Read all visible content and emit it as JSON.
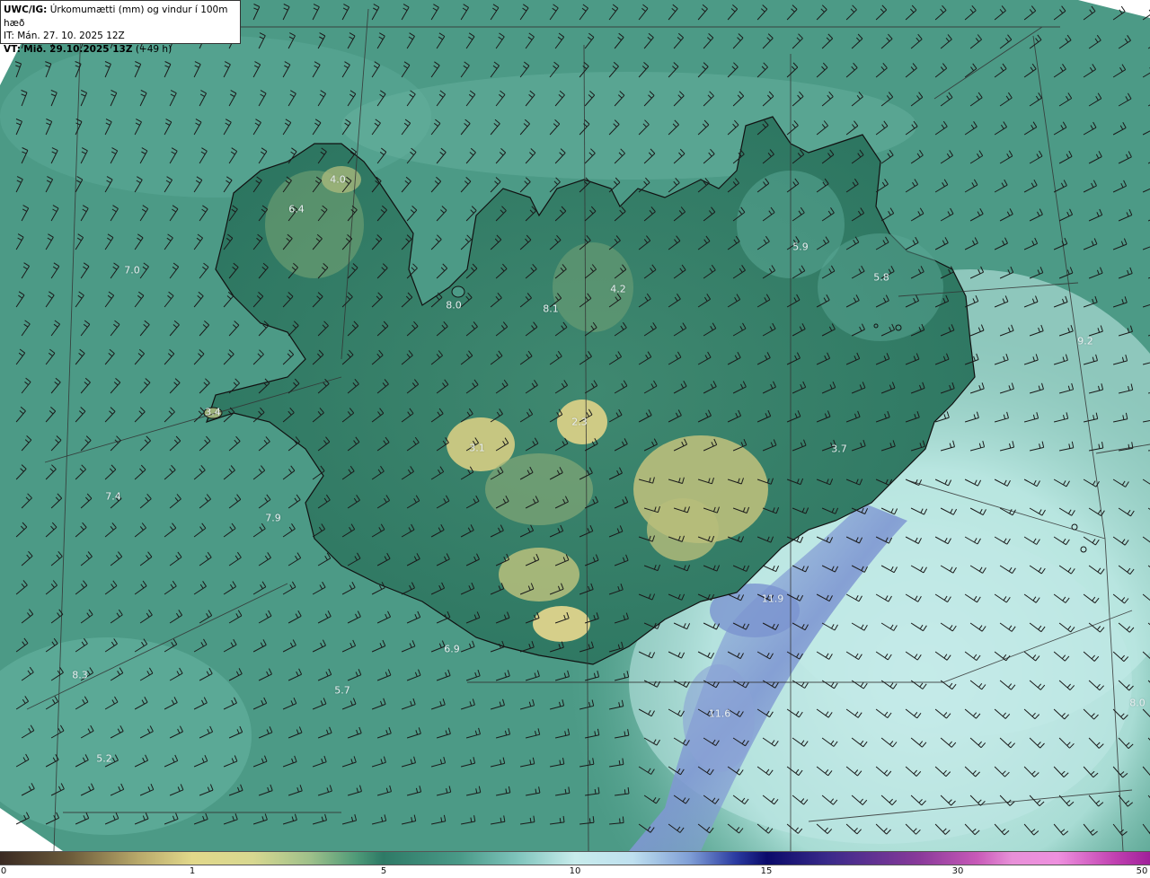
{
  "header": {
    "product": "UWC/IG:",
    "title": "Úrkomumætti (mm) og vindur í 100m hæð",
    "it_label": "IT: Mán. 27. 10. 2025 12Z",
    "vt_prefix": "VT:",
    "vt_value": "Mið. 29.10.2025 13Z",
    "vt_lead": "(+49 h)"
  },
  "map": {
    "region": "Iceland",
    "field": "precipitable water (mm)",
    "overlay": "wind barbs at 100 m",
    "colors": {
      "ocean": "#4a9c8a",
      "land_dark": "#2f7a64",
      "land_high": "#c8c878",
      "moist_ocean": "#bfe8e8",
      "moist_band": "#8aa8d8",
      "barb": "#1a1a1a",
      "coast": "#111111",
      "grid": "#333333"
    },
    "value_labels": [
      {
        "text": "4.0"
      },
      {
        "text": "6.4"
      },
      {
        "text": "7.0"
      },
      {
        "text": "8.0"
      },
      {
        "text": "8.1"
      },
      {
        "text": "4.2"
      },
      {
        "text": "5.9"
      },
      {
        "text": "5.8"
      },
      {
        "text": "3.4"
      },
      {
        "text": "3.1"
      },
      {
        "text": "2.3"
      },
      {
        "text": "3.7"
      },
      {
        "text": "7.4"
      },
      {
        "text": "7.9"
      },
      {
        "text": "6.9"
      },
      {
        "text": "11.9"
      },
      {
        "text": "8.3"
      },
      {
        "text": "5.7"
      },
      {
        "text": "11.6"
      },
      {
        "text": "5.2"
      },
      {
        "text": "9.2"
      },
      {
        "text": "8.0"
      }
    ]
  },
  "colorbar": {
    "unit": "mm",
    "ticks": [
      "0",
      "1",
      "5",
      "10",
      "15",
      "30",
      "50"
    ]
  }
}
